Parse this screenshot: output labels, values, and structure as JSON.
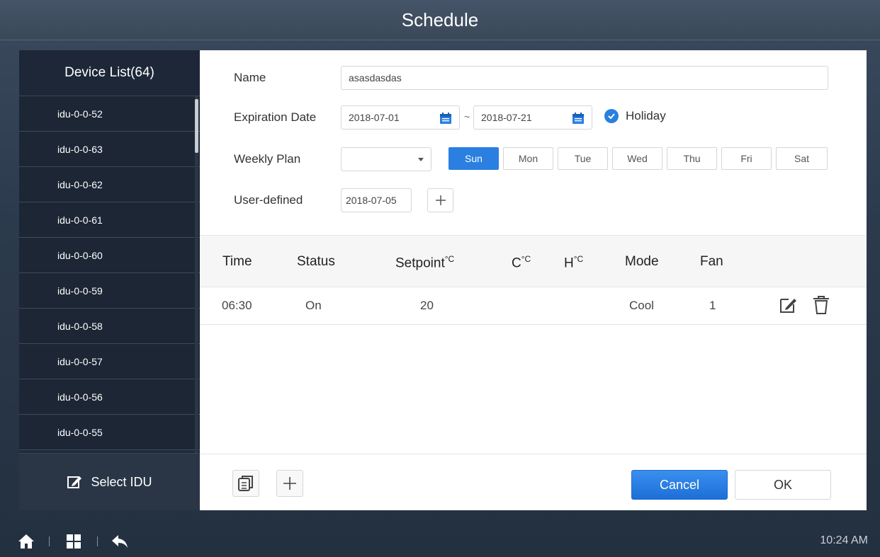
{
  "window": {
    "title": "Schedule"
  },
  "sidebar": {
    "header": "Device List(64)",
    "items": [
      {
        "label": "idu-0-0-52"
      },
      {
        "label": "idu-0-0-63"
      },
      {
        "label": "idu-0-0-62"
      },
      {
        "label": "idu-0-0-61"
      },
      {
        "label": "idu-0-0-60"
      },
      {
        "label": "idu-0-0-59"
      },
      {
        "label": "idu-0-0-58"
      },
      {
        "label": "idu-0-0-57"
      },
      {
        "label": "idu-0-0-56"
      },
      {
        "label": "idu-0-0-55"
      }
    ],
    "select_button": "Select IDU"
  },
  "form": {
    "name_label": "Name",
    "name_value": "asasdasdas",
    "expiration_label": "Expiration Date",
    "start_date": "2018-07-01",
    "separator": "~",
    "end_date": "2018-07-21",
    "holiday_label": "Holiday",
    "holiday_checked": true,
    "weekly_label": "Weekly Plan",
    "weekly_select_value": "",
    "days": [
      {
        "label": "Sun",
        "active": true
      },
      {
        "label": "Mon",
        "active": false
      },
      {
        "label": "Tue",
        "active": false
      },
      {
        "label": "Wed",
        "active": false
      },
      {
        "label": "Thu",
        "active": false
      },
      {
        "label": "Fri",
        "active": false
      },
      {
        "label": "Sat",
        "active": false
      }
    ],
    "user_defined_label": "User-defined",
    "user_defined_date": "2018-07-05"
  },
  "table": {
    "headers": {
      "time": "Time",
      "status": "Status",
      "setpoint": "Setpoint",
      "setpoint_unit": "°C",
      "cool": "C",
      "cool_unit": "°C",
      "heat": "H",
      "heat_unit": "°C",
      "mode": "Mode",
      "fan": "Fan"
    },
    "rows": [
      {
        "time": "06:30",
        "status": "On",
        "setpoint": "20",
        "cool": "",
        "heat": "",
        "mode": "Cool",
        "fan": "1"
      }
    ]
  },
  "footer": {
    "cancel_label": "Cancel",
    "ok_label": "OK"
  },
  "taskbar": {
    "time": "10:24 AM"
  },
  "colors": {
    "accent": "#2a7fe0",
    "sidebar_bg": "#1f2a3a",
    "titlebar_bg": "#3f4e62"
  }
}
